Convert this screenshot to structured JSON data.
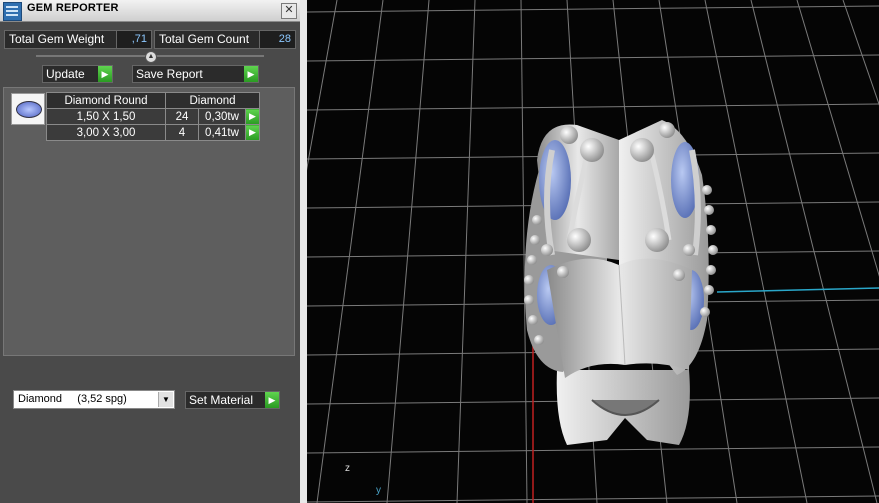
{
  "window": {
    "title": "GEM REPORTER",
    "close_glyph": "✕"
  },
  "summary": {
    "total_weight_label": "Total Gem Weight",
    "total_weight_value": ",71",
    "total_count_label": "Total Gem Count",
    "total_count_value": "28"
  },
  "actions": {
    "update_label": "Update",
    "save_report_label": "Save Report",
    "go_glyph": "▶"
  },
  "report": {
    "icon": "diamond-round-icon",
    "columns": [
      "Diamond Round",
      "Diamond"
    ],
    "rows": [
      {
        "size": "1,50 X 1,50",
        "count": "24",
        "weight": "0,30tw"
      },
      {
        "size": "3,00 X 3,00",
        "count": "4",
        "weight": "0,41tw"
      }
    ]
  },
  "material": {
    "selected": "Diamond     (3,52 spg)",
    "set_label": "Set Material"
  },
  "viewport": {
    "axis_z": "z",
    "axis_y": "y",
    "colors": {
      "background": "#050505",
      "grid": "#7a7a7a",
      "axis_x": "#c02020",
      "axis_y": "#2aa7c9",
      "metal": "#d9d9d9",
      "gem": "#6f8fd8"
    }
  }
}
